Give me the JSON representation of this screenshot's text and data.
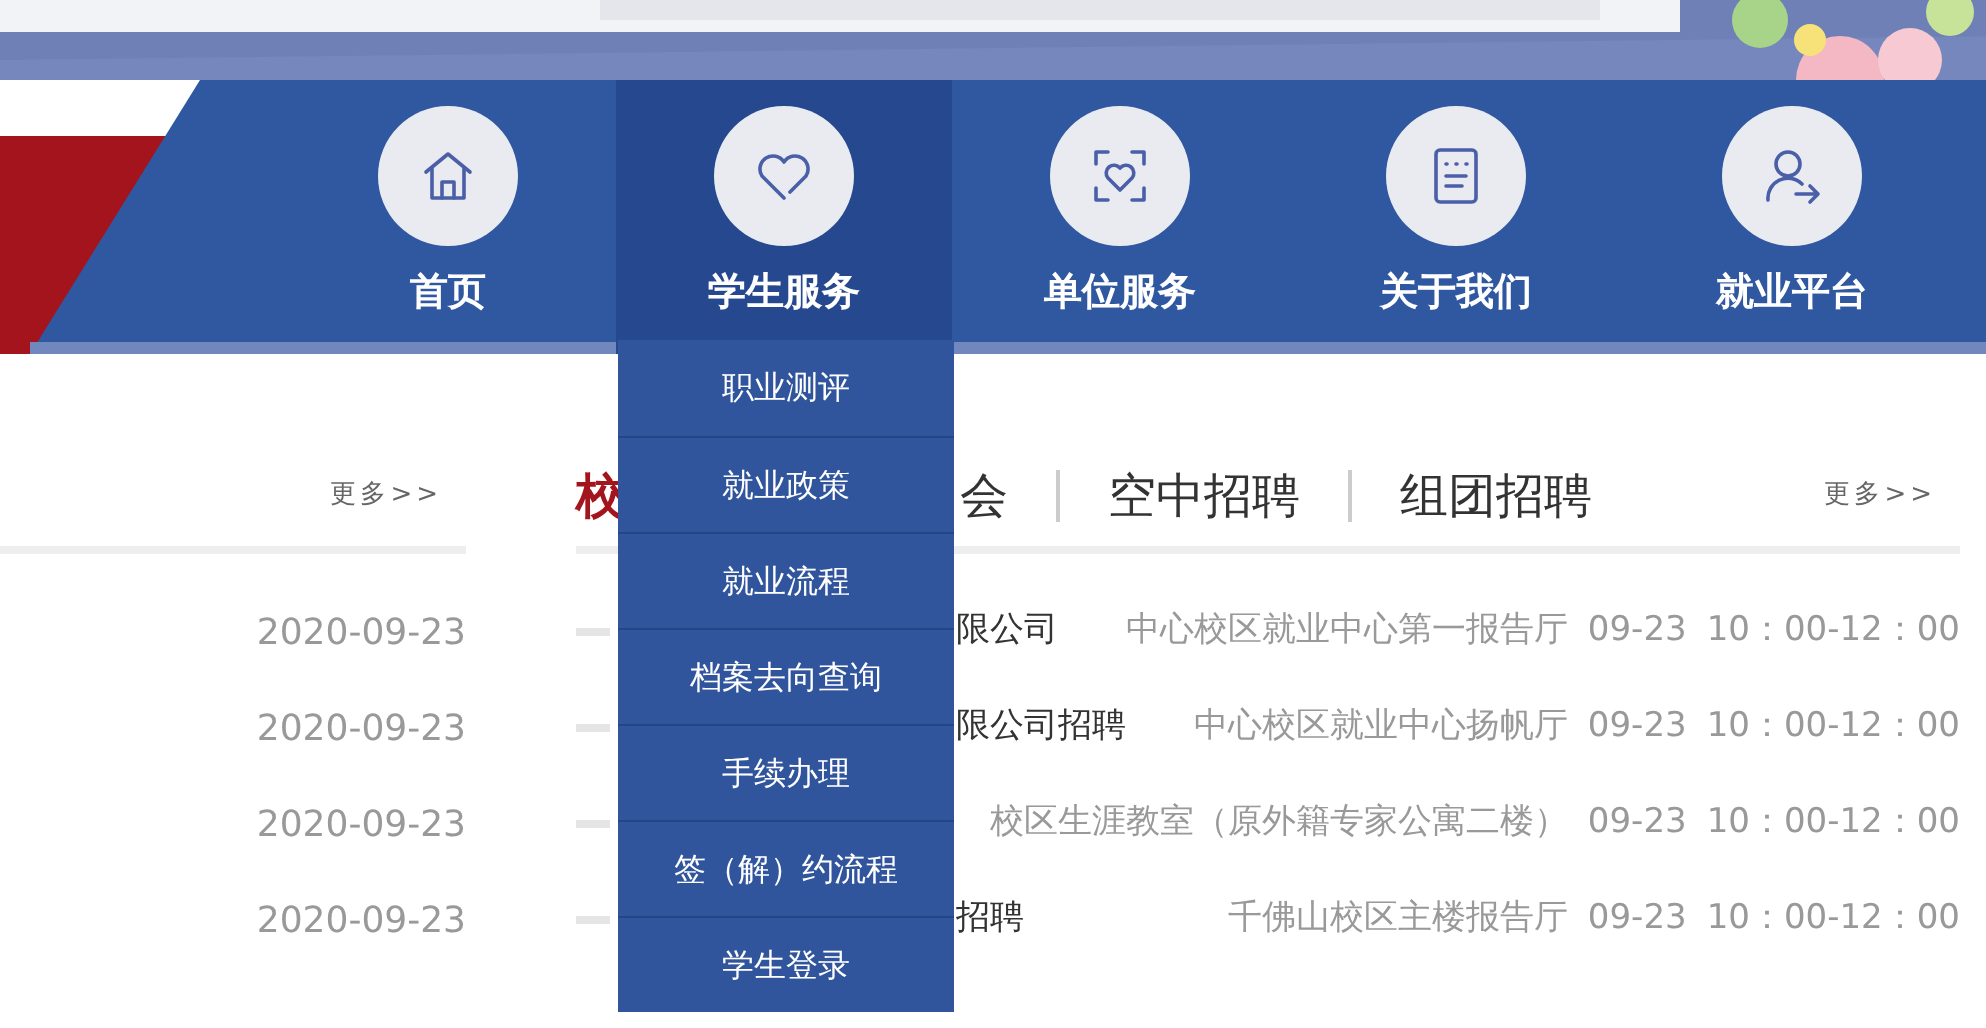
{
  "nav": {
    "items": [
      {
        "label": "首页",
        "selected": false
      },
      {
        "label": "学生服务",
        "selected": true
      },
      {
        "label": "单位服务",
        "selected": false
      },
      {
        "label": "关于我们",
        "selected": false
      },
      {
        "label": "就业平台",
        "selected": false
      }
    ]
  },
  "dropdown": {
    "items": [
      "职业测评",
      "就业政策",
      "就业流程",
      "档案去向查询",
      "手续办理",
      "签（解）约流程",
      "学生登录"
    ]
  },
  "left_panel": {
    "more": "更多>>",
    "dates": [
      "2020-09-23",
      "2020-09-23",
      "2020-09-23",
      "2020-09-23"
    ]
  },
  "right_panel": {
    "tabs": [
      {
        "label": "校",
        "selected": true
      },
      {
        "label": "会",
        "selected": false
      },
      {
        "label": "空中招聘",
        "selected": false
      },
      {
        "label": "组团招聘",
        "selected": false
      }
    ],
    "more": "更多>>",
    "rows": [
      {
        "title": "限公司",
        "location": "中心校区就业中心第一报告厅",
        "date": "09-23",
        "time": "10：00-12：00"
      },
      {
        "title": "限公司招聘",
        "location": "中心校区就业中心扬帆厅",
        "date": "09-23",
        "time": "10：00-12：00"
      },
      {
        "location": "校区生涯教室（原外籍专家公寓二楼）",
        "date": "09-23",
        "time": "10：00-12：00"
      },
      {
        "title": "招聘",
        "location": "千佛山校区主楼报告厅",
        "date": "09-23",
        "time": "10：00-12：00"
      }
    ]
  }
}
